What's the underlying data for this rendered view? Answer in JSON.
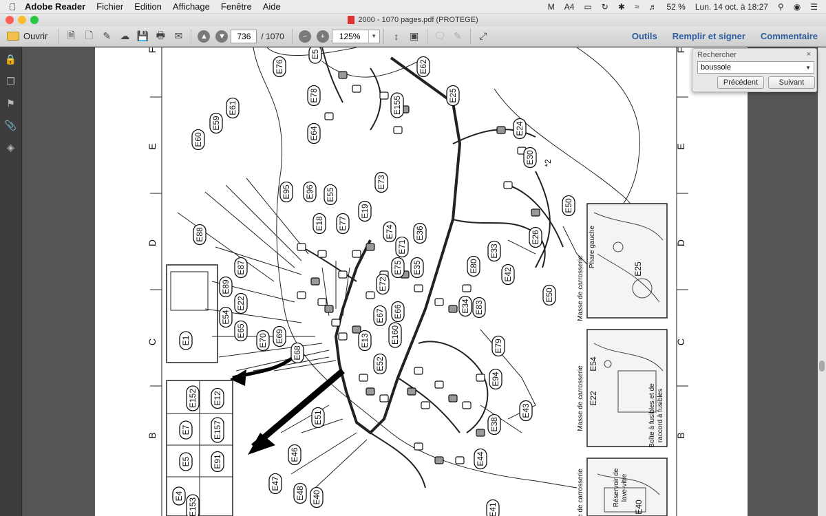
{
  "menubar": {
    "app_name": "Adobe Reader",
    "items": [
      "Fichier",
      "Edition",
      "Affichage",
      "Fenêtre",
      "Aide"
    ],
    "battery": "52 %",
    "clock": "Lun. 14 oct. à 18:27",
    "tray_count": "4"
  },
  "window": {
    "title": "2000 - 1070 pages.pdf (PROTEGE)"
  },
  "toolbar": {
    "open_label": "Ouvrir",
    "page_current": "736",
    "page_total": "/ 1070",
    "zoom": "125%",
    "tools_label": "Outils",
    "fill_sign_label": "Remplir et signer",
    "comment_label": "Commentaire"
  },
  "search": {
    "title": "Rechercher",
    "close": "×",
    "query": "boussole",
    "prev_label": "Précédent",
    "next_label": "Suivant"
  },
  "diagram": {
    "grid_letters": [
      "F",
      "E",
      "D",
      "C",
      "B"
    ],
    "connectors": [
      "E76",
      "E5",
      "E62",
      "E78",
      "E155",
      "E25",
      "E64",
      "E24",
      "E30",
      "*2",
      "E50",
      "E61",
      "E59",
      "E60",
      "E95",
      "E96",
      "E55",
      "E73",
      "E18",
      "E77",
      "E19",
      "E88",
      "E74",
      "E36",
      "E71",
      "E26",
      "E33",
      "E87",
      "E72",
      "E75",
      "E35",
      "E80",
      "E42",
      "E50",
      "E89",
      "E66",
      "E22",
      "E54",
      "E67",
      "E34",
      "E83",
      "E65",
      "E160",
      "E70",
      "E69",
      "E13",
      "E68",
      "E52",
      "E79",
      "E94",
      "E43",
      "E1",
      "E152",
      "E12",
      "E7",
      "E157",
      "E5",
      "E91",
      "E4",
      "E153",
      "E51",
      "E46",
      "E38",
      "E44",
      "E47",
      "E48",
      "E40",
      "E41"
    ],
    "inset_labels": {
      "phare": "Phare gauche",
      "masse1": "Masse de carrosserie",
      "inset_e25": "E25",
      "masse2": "Masse de carrosserie",
      "inset_e54": "E54",
      "inset_e22": "E22",
      "boite1": "Boîte à fusibles et de",
      "boite2": "raccord à fusibles",
      "masse3": "Masse de carrosserie",
      "reservoir1": "Réservoir de",
      "reservoir2": "lave-vitre",
      "inset_e40": "E40"
    }
  }
}
